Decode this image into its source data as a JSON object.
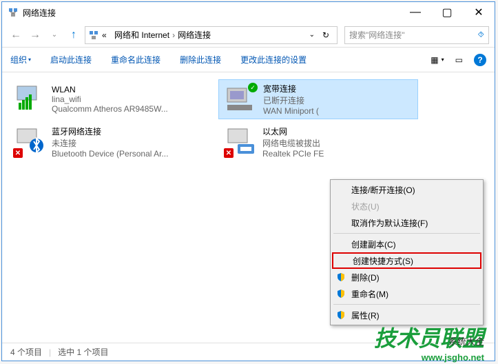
{
  "window": {
    "title": "网络连接",
    "controls": {
      "minimize": "—",
      "maximize": "▢",
      "close": "✕"
    }
  },
  "nav": {
    "back": "←",
    "forward": "→",
    "up": "↑",
    "breadcrumb": {
      "chevrons": "«",
      "parent": "网络和 Internet",
      "current": "网络连接",
      "sep": "›"
    },
    "dropdown": "⌄",
    "refresh": "↻",
    "search_placeholder": "搜索\"网络连接\"",
    "search_icon": "🔍"
  },
  "toolbar": {
    "organize": "组织",
    "start_conn": "启动此连接",
    "rename_conn": "重命名此连接",
    "delete_conn": "删除此连接",
    "change_settings": "更改此连接的设置",
    "view_icon": "▦",
    "preview_icon": "▭"
  },
  "connections": [
    {
      "name": "WLAN",
      "status": "lina_wifi",
      "device": "Qualcomm Atheros AR9485W...",
      "icon": "wifi",
      "selected": false
    },
    {
      "name": "宽带连接",
      "status": "已断开连接",
      "device": "WAN Miniport (",
      "icon": "broadband",
      "selected": true,
      "checked": true
    },
    {
      "name": "蓝牙网络连接",
      "status": "未连接",
      "device": "Bluetooth Device (Personal Ar...",
      "icon": "bluetooth",
      "selected": false,
      "disabled": true
    },
    {
      "name": "以太网",
      "status": "网络电缆被拔出",
      "device": "Realtek PCIe FE",
      "icon": "ethernet",
      "selected": false,
      "disabled": true
    }
  ],
  "context_menu": [
    {
      "label": "连接/断开连接(O)",
      "type": "item"
    },
    {
      "label": "状态(U)",
      "type": "item",
      "disabled": true
    },
    {
      "label": "取消作为默认连接(F)",
      "type": "item"
    },
    {
      "type": "sep"
    },
    {
      "label": "创建副本(C)",
      "type": "item"
    },
    {
      "label": "创建快捷方式(S)",
      "type": "item",
      "highlighted": true
    },
    {
      "label": "删除(D)",
      "type": "item",
      "shield": true
    },
    {
      "label": "重命名(M)",
      "type": "item",
      "shield": true
    },
    {
      "type": "sep"
    },
    {
      "label": "属性(R)",
      "type": "item",
      "shield": true
    }
  ],
  "statusbar": {
    "count": "4 个项目",
    "selected": "选中 1 个项目"
  },
  "watermark": {
    "main": "技术员联盟",
    "sub": "系统大全",
    "url": "www.jsgho.net"
  }
}
